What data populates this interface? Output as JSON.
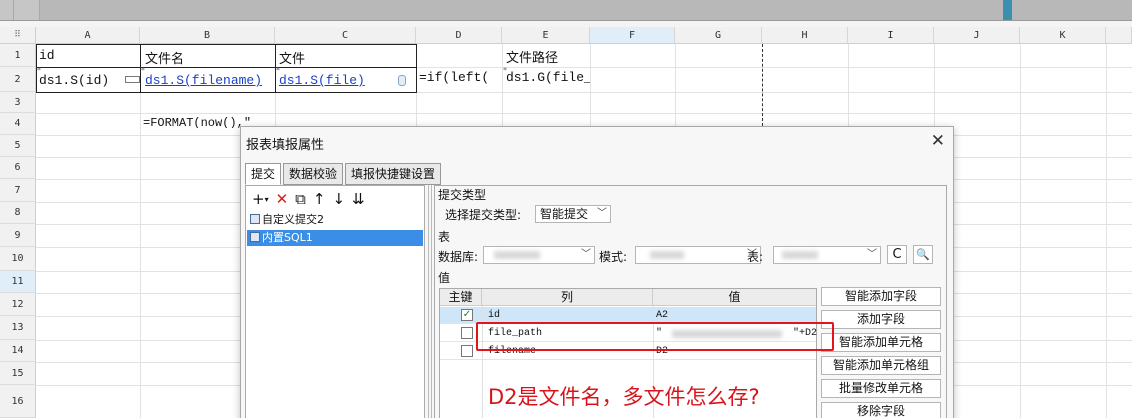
{
  "grid": {
    "columns": [
      "A",
      "B",
      "C",
      "D",
      "E",
      "F",
      "G",
      "H",
      "I",
      "J",
      "K"
    ],
    "rows": [
      "1",
      "2",
      "3",
      "4",
      "5",
      "6",
      "7",
      "8",
      "9",
      "10",
      "11",
      "12",
      "13",
      "14",
      "15",
      "16"
    ],
    "corner": "⠿",
    "cells": {
      "A1": "id",
      "B1": "文件名",
      "C1": "文件",
      "E1": "文件路径",
      "A2": "ds1.S(id)",
      "B2": "ds1.S(filename)",
      "C2": "ds1.S(file)",
      "D2": "=if(left(",
      "E2": "ds1.G(file_",
      "B4": "=FORMAT(now(),\""
    }
  },
  "dialog": {
    "title": "报表填报属性",
    "close": "✕",
    "tabs": [
      "提交",
      "数据校验",
      "填报快捷键设置"
    ],
    "toolbar": {
      "add": "+",
      "add_arrow": "▾",
      "delete": "✕",
      "copy": "⧉",
      "up": "↑",
      "down": "↓",
      "sort": "⇊"
    },
    "submit_list": [
      "自定义提交2",
      "内置SQL1"
    ],
    "submit_type_group": "提交类型",
    "submit_type_label": "选择提交类型:",
    "submit_type_value": "智能提交",
    "table_group": "表",
    "db_label": "数据库:",
    "mode_label": "模式:",
    "table_label": "表:",
    "refresh_icon": "C",
    "search_icon": "🔍",
    "values_group": "值",
    "value_table": {
      "headers": [
        "主键",
        "列",
        "值"
      ],
      "rows": [
        {
          "key": true,
          "column": "id",
          "value": "A2"
        },
        {
          "key": false,
          "column": "file_path",
          "value": "\"",
          "value_suffix": "\"+D2"
        },
        {
          "key": false,
          "column": "filename",
          "value": "D2"
        }
      ]
    },
    "side_buttons": [
      "智能添加字段",
      "添加字段",
      "智能添加单元格",
      "智能添加单元格组",
      "批量修改单元格",
      "移除字段"
    ]
  },
  "annotation": "D2是文件名，多文件怎么存?",
  "colors": {
    "annotation": "#d8141a",
    "selection": "#3a8ee6",
    "link": "#1a3fc9"
  }
}
